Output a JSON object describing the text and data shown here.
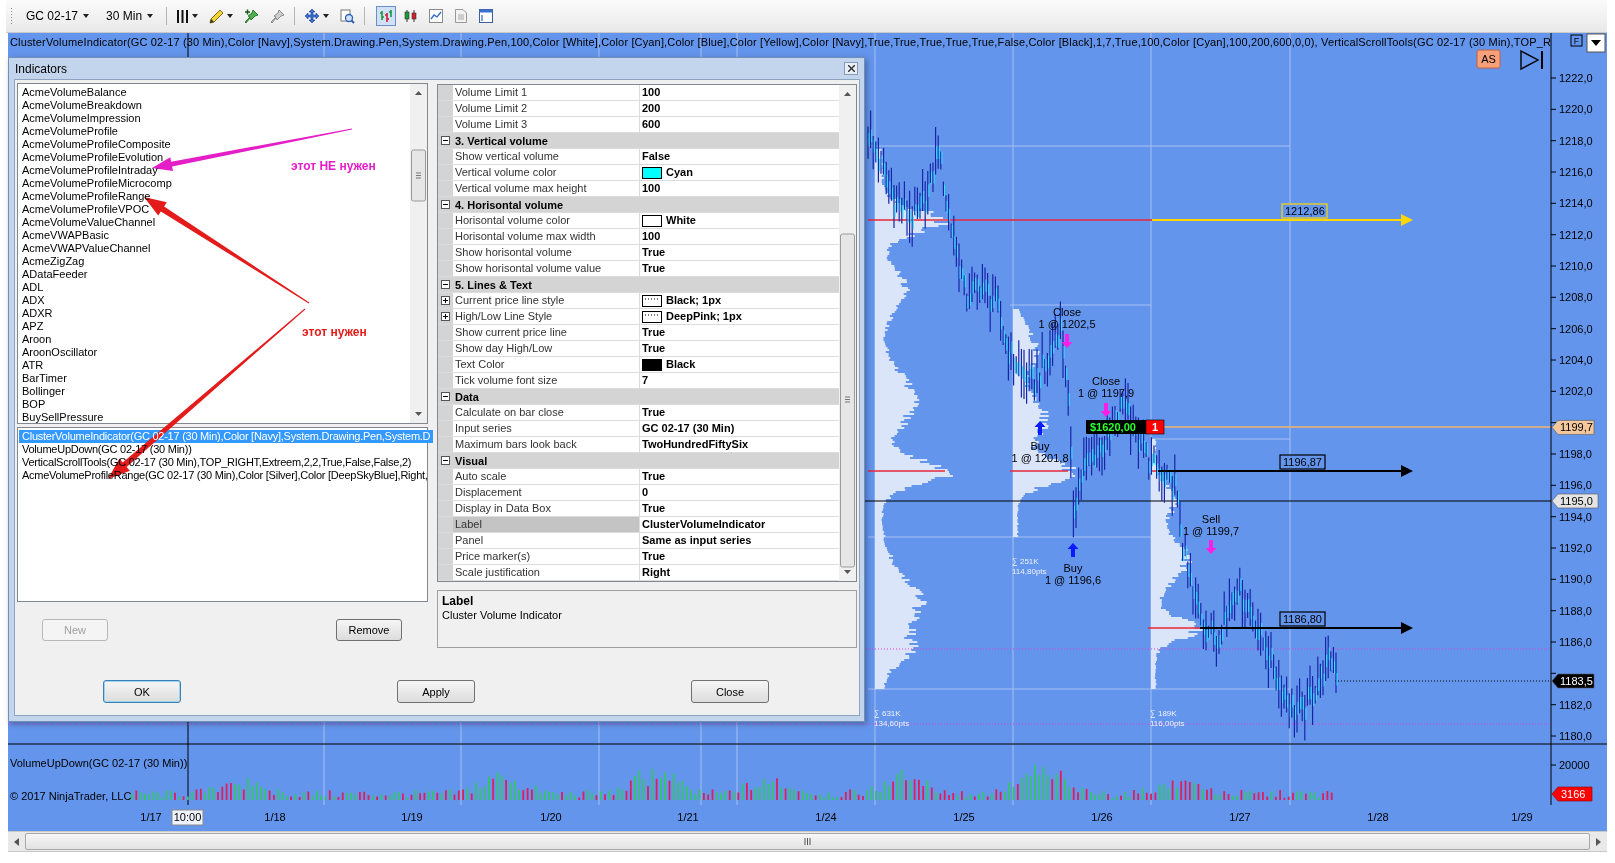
{
  "toolbar": {
    "instrument": "GC 02-17",
    "interval": "30 Min",
    "view_buttons": [
      {
        "selected": true
      },
      {
        "selected": false
      },
      {
        "selected": false
      },
      {
        "selected": false
      },
      {
        "selected": false
      }
    ]
  },
  "chart": {
    "legend": "ClusterVolumeIndicator(GC 02-17 (30 Min),Color [Navy],System.Drawing.Pen,System.Drawing.Pen,100,Color [White],Color [Cyan],Color [Blue],Color [Yellow],Color [Navy],True,True,True,True,True,False,Color [Black],1,7,True,100,Color [Cyan],100,200,600,0,0), VerticalScrollTools(GC 02-17 (30 Min),TOP_R",
    "f_button": "F",
    "as_button": "AS",
    "price_labels": [
      "1222,0",
      "1220,0",
      "1218,0",
      "1216,0",
      "1214,0",
      "1212,0",
      "1210,0",
      "1208,0",
      "1206,0",
      "1204,0",
      "1202,0",
      "1198,0",
      "1196,0",
      "1194,0",
      "1192,0",
      "1190,0",
      "1188,0",
      "1186,0",
      "1182,0",
      "1180,0"
    ],
    "price_markers": [
      {
        "text": "1199,7",
        "color": "#f4c89c"
      },
      {
        "text": "1195,0",
        "color": "#e4e4e4"
      },
      {
        "text": "1183,5",
        "color": "#000000"
      }
    ],
    "levels": [
      {
        "label": "1212,86",
        "color": "#ffd700"
      },
      {
        "label": "1196,87",
        "color": "#000000"
      },
      {
        "label": "1186,80",
        "color": "#000000"
      }
    ],
    "trades": [
      {
        "kind": "close",
        "action": "Close",
        "fill": "1 @ 1202,5"
      },
      {
        "kind": "close",
        "action": "Close",
        "fill": "1 @ 1197,9"
      },
      {
        "kind": "buy",
        "action": "Buy",
        "fill": "1 @ 1201,8"
      },
      {
        "kind": "sell",
        "action": "Sell",
        "fill": "1 @ 1199,7"
      },
      {
        "kind": "buy",
        "action": "Buy",
        "fill": "1 @ 1196,6"
      }
    ],
    "position": {
      "pnl": "$1620,00",
      "quantity": "1"
    },
    "profile_stats": [
      {
        "volume": "∑ 631K",
        "range": "134,60pts"
      },
      {
        "volume": "∑ 251K",
        "range": "114,80pts"
      },
      {
        "volume": "∑ 189K",
        "range": "116,00pts"
      }
    ],
    "volume_panel": {
      "title": "VolumeUpDown(GC 02-17 (30 Min))",
      "axis_label": "20000",
      "marker": "3166"
    },
    "copyright": "© 2017 NinjaTrader, LLC",
    "date_labels": [
      "1/17",
      "1/18",
      "1/19",
      "1/20",
      "1/21",
      "1/24",
      "1/25",
      "1/26",
      "1/27",
      "1/28",
      "1/29"
    ],
    "cursor_time": "10:00"
  },
  "dialog": {
    "title": "Indicators",
    "available": [
      {
        "name": "AcmeVolumeBalance",
        "selected": false
      },
      {
        "name": "AcmeVolumeBreakdown",
        "selected": false
      },
      {
        "name": "AcmeVolumeImpression",
        "selected": false
      },
      {
        "name": "AcmeVolumeProfile",
        "selected": false
      },
      {
        "name": "AcmeVolumeProfileComposite",
        "selected": false
      },
      {
        "name": "AcmeVolumeProfileEvolution",
        "selected": false
      },
      {
        "name": "AcmeVolumeProfileIntraday",
        "selected": false
      },
      {
        "name": "AcmeVolumeProfileMicrocomp",
        "selected": false
      },
      {
        "name": "AcmeVolumeProfileRange",
        "selected": false
      },
      {
        "name": "AcmeVolumeProfileVPOC",
        "selected": false
      },
      {
        "name": "AcmeVolumeValueChannel",
        "selected": false
      },
      {
        "name": "AcmeVWAPBasic",
        "selected": false
      },
      {
        "name": "AcmeVWAPValueChannel",
        "selected": false
      },
      {
        "name": "AcmeZigZag",
        "selected": false
      },
      {
        "name": "ADataFeeder",
        "selected": false
      },
      {
        "name": "ADL",
        "selected": false
      },
      {
        "name": "ADX",
        "selected": false
      },
      {
        "name": "ADXR",
        "selected": false
      },
      {
        "name": "APZ",
        "selected": false
      },
      {
        "name": "Aroon",
        "selected": false
      },
      {
        "name": "AroonOscillator",
        "selected": false
      },
      {
        "name": "ATR",
        "selected": false
      },
      {
        "name": "BarTimer",
        "selected": false
      },
      {
        "name": "Bollinger",
        "selected": false
      },
      {
        "name": "BOP",
        "selected": false
      },
      {
        "name": "BuySellPressure",
        "selected": false
      }
    ],
    "applied": [
      {
        "text": "ClusterVolumeIndicator(GC 02-17 (30 Min),Color [Navy],System.Drawing.Pen,System.D",
        "selected": true
      },
      {
        "text": "VolumeUpDown(GC 02-17 (30 Min))",
        "selected": false
      },
      {
        "text": "VerticalScrollTools(GC 02-17 (30 Min),TOP_RIGHT,Extreem,2,2,True,False,False,2)",
        "selected": false
      },
      {
        "text": "AcmeVolumeProfileRange(GC 02-17 (30 Min),Color [Silver],Color [DeepSkyBlue],Right,",
        "selected": false
      }
    ],
    "list_buttons": [
      {
        "label": "New",
        "disabled": true
      },
      {
        "label": "Remove",
        "disabled": false
      }
    ],
    "properties": {
      "leading_rows": [
        {
          "name": "Volume Limit 1",
          "value": "100",
          "kind": "text",
          "selected": false
        },
        {
          "name": "Volume Limit 2",
          "value": "200",
          "kind": "text",
          "selected": false
        },
        {
          "name": "Volume Limit 3",
          "value": "600",
          "kind": "text",
          "selected": false
        }
      ],
      "groups": [
        {
          "title": "3. Vertical volume",
          "expanded": true,
          "rows": [
            {
              "name": "Show vertical volume",
              "value": "False",
              "kind": "text",
              "selected": false
            },
            {
              "name": "Vertical volume color",
              "value": "Cyan",
              "kind": "color",
              "color": "#00ffff",
              "selected": false
            },
            {
              "name": "Vertical volume max height",
              "value": "100",
              "kind": "text",
              "selected": false
            }
          ]
        },
        {
          "title": "4. Horisontal volume",
          "expanded": true,
          "rows": [
            {
              "name": "Horisontal volume color",
              "value": "White",
              "kind": "color",
              "color": "#ffffff",
              "selected": false
            },
            {
              "name": "Horisontal volume max width",
              "value": "100",
              "kind": "text",
              "selected": false
            },
            {
              "name": "Show horisontal volume",
              "value": "True",
              "kind": "text",
              "selected": false
            },
            {
              "name": "Show horisontal volume value",
              "value": "True",
              "kind": "text",
              "selected": false
            }
          ]
        },
        {
          "title": "5. Lines & Text",
          "expanded": true,
          "rows": [
            {
              "name": "Current price line style",
              "value": "Black; 1px",
              "kind": "pen",
              "selected": false
            },
            {
              "name": "High/Low Line Style",
              "value": "DeepPink; 1px",
              "kind": "pen",
              "selected": false
            },
            {
              "name": "Show current price line",
              "value": "True",
              "kind": "text",
              "selected": false
            },
            {
              "name": "Show day High/Low",
              "value": "True",
              "kind": "text",
              "selected": false
            },
            {
              "name": "Text Color",
              "value": "Black",
              "kind": "color",
              "color": "#000000",
              "selected": false
            },
            {
              "name": "Tick volume font size",
              "value": "7",
              "kind": "text",
              "selected": false
            }
          ]
        },
        {
          "title": "Data",
          "expanded": true,
          "rows": [
            {
              "name": "Calculate on bar close",
              "value": "True",
              "kind": "text",
              "selected": false
            },
            {
              "name": "Input series",
              "value": "GC 02-17 (30 Min)",
              "kind": "text",
              "selected": false
            },
            {
              "name": "Maximum bars look back",
              "value": "TwoHundredFiftySix",
              "kind": "text",
              "selected": false
            }
          ]
        },
        {
          "title": "Visual",
          "expanded": true,
          "rows": [
            {
              "name": "Auto scale",
              "value": "True",
              "kind": "text",
              "selected": false
            },
            {
              "name": "Displacement",
              "value": "0",
              "kind": "text",
              "selected": false
            },
            {
              "name": "Display in Data Box",
              "value": "True",
              "kind": "text",
              "selected": false
            },
            {
              "name": "Label",
              "value": "ClusterVolumeIndicator",
              "kind": "text",
              "selected": true
            },
            {
              "name": "Panel",
              "value": "Same as input series",
              "kind": "text",
              "selected": false
            },
            {
              "name": "Price marker(s)",
              "value": "True",
              "kind": "text",
              "selected": false
            },
            {
              "name": "Scale justification",
              "value": "Right",
              "kind": "text",
              "selected": false
            }
          ]
        }
      ]
    },
    "description": {
      "title": "Label",
      "text": "Cluster Volume Indicator"
    },
    "buttons": [
      {
        "label": "OK",
        "default": true
      },
      {
        "label": "Apply",
        "default": false
      },
      {
        "label": "Close",
        "default": false
      }
    ]
  },
  "annotations": [
    {
      "text": "этот НЕ нужен",
      "color": "#e61ec8"
    },
    {
      "text": "этот нужен",
      "color": "#e31b1b"
    }
  ]
}
